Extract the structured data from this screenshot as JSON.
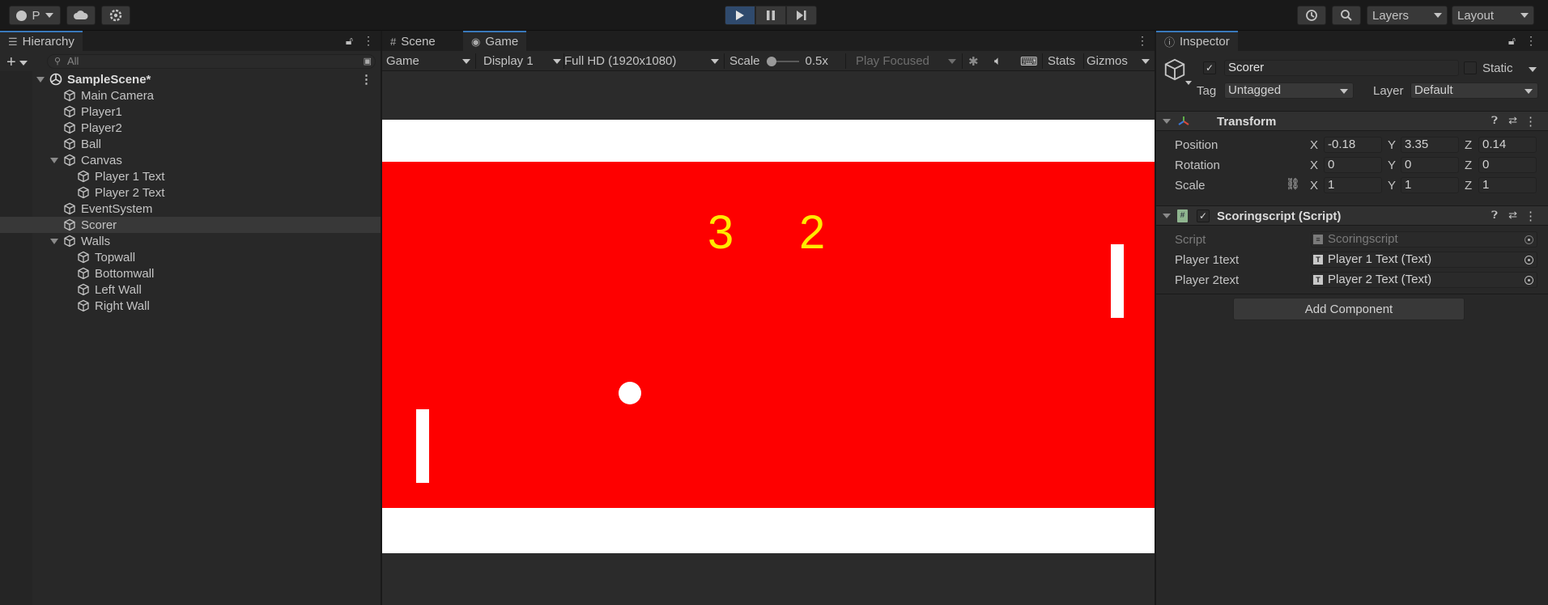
{
  "toolbar": {
    "account_label": "P",
    "layers_label": "Layers",
    "layout_label": "Layout"
  },
  "hierarchy": {
    "tab_label": "Hierarchy",
    "search_placeholder": "All",
    "items": [
      {
        "label": "SampleScene*",
        "kind": "scene"
      },
      {
        "label": "Main Camera"
      },
      {
        "label": "Player1"
      },
      {
        "label": "Player2"
      },
      {
        "label": "Ball"
      },
      {
        "label": "Canvas"
      },
      {
        "label": "Player 1 Text"
      },
      {
        "label": "Player 2 Text"
      },
      {
        "label": "EventSystem"
      },
      {
        "label": "Scorer"
      },
      {
        "label": "Walls"
      },
      {
        "label": "Topwall"
      },
      {
        "label": "Bottomwall"
      },
      {
        "label": "Left Wall"
      },
      {
        "label": "Right Wall"
      }
    ]
  },
  "view": {
    "scene_tab": "Scene",
    "game_tab": "Game",
    "game_dropdown": "Game",
    "display": "Display 1",
    "resolution": "Full HD (1920x1080)",
    "scale_label": "Scale",
    "scale_value": "0.5x",
    "play_focused": "Play Focused",
    "stats": "Stats",
    "gizmos": "Gizmos"
  },
  "game": {
    "score_left": "3",
    "score_right": "2",
    "court_color": "#fe0000",
    "wall_color": "#ffffff",
    "score_color": "#ffea00"
  },
  "inspector": {
    "tab_label": "Inspector",
    "object_name": "Scorer",
    "static_label": "Static",
    "tag_label": "Tag",
    "tag_value": "Untagged",
    "layer_label": "Layer",
    "layer_value": "Default",
    "transform": {
      "title": "Transform",
      "position_label": "Position",
      "rotation_label": "Rotation",
      "scale_label": "Scale",
      "position": {
        "x": "-0.18",
        "y": "3.35",
        "z": "0.14"
      },
      "rotation": {
        "x": "0",
        "y": "0",
        "z": "0"
      },
      "scale": {
        "x": "1",
        "y": "1",
        "z": "1"
      },
      "axis_x": "X",
      "axis_y": "Y",
      "axis_z": "Z"
    },
    "script_component": {
      "title": "Scoringscript (Script)",
      "script_label": "Script",
      "script_value": "Scoringscript",
      "p1_label": "Player 1text",
      "p1_value": "Player 1 Text (Text)",
      "p2_label": "Player 2text",
      "p2_value": "Player 2 Text (Text)"
    },
    "add_component": "Add Component"
  }
}
